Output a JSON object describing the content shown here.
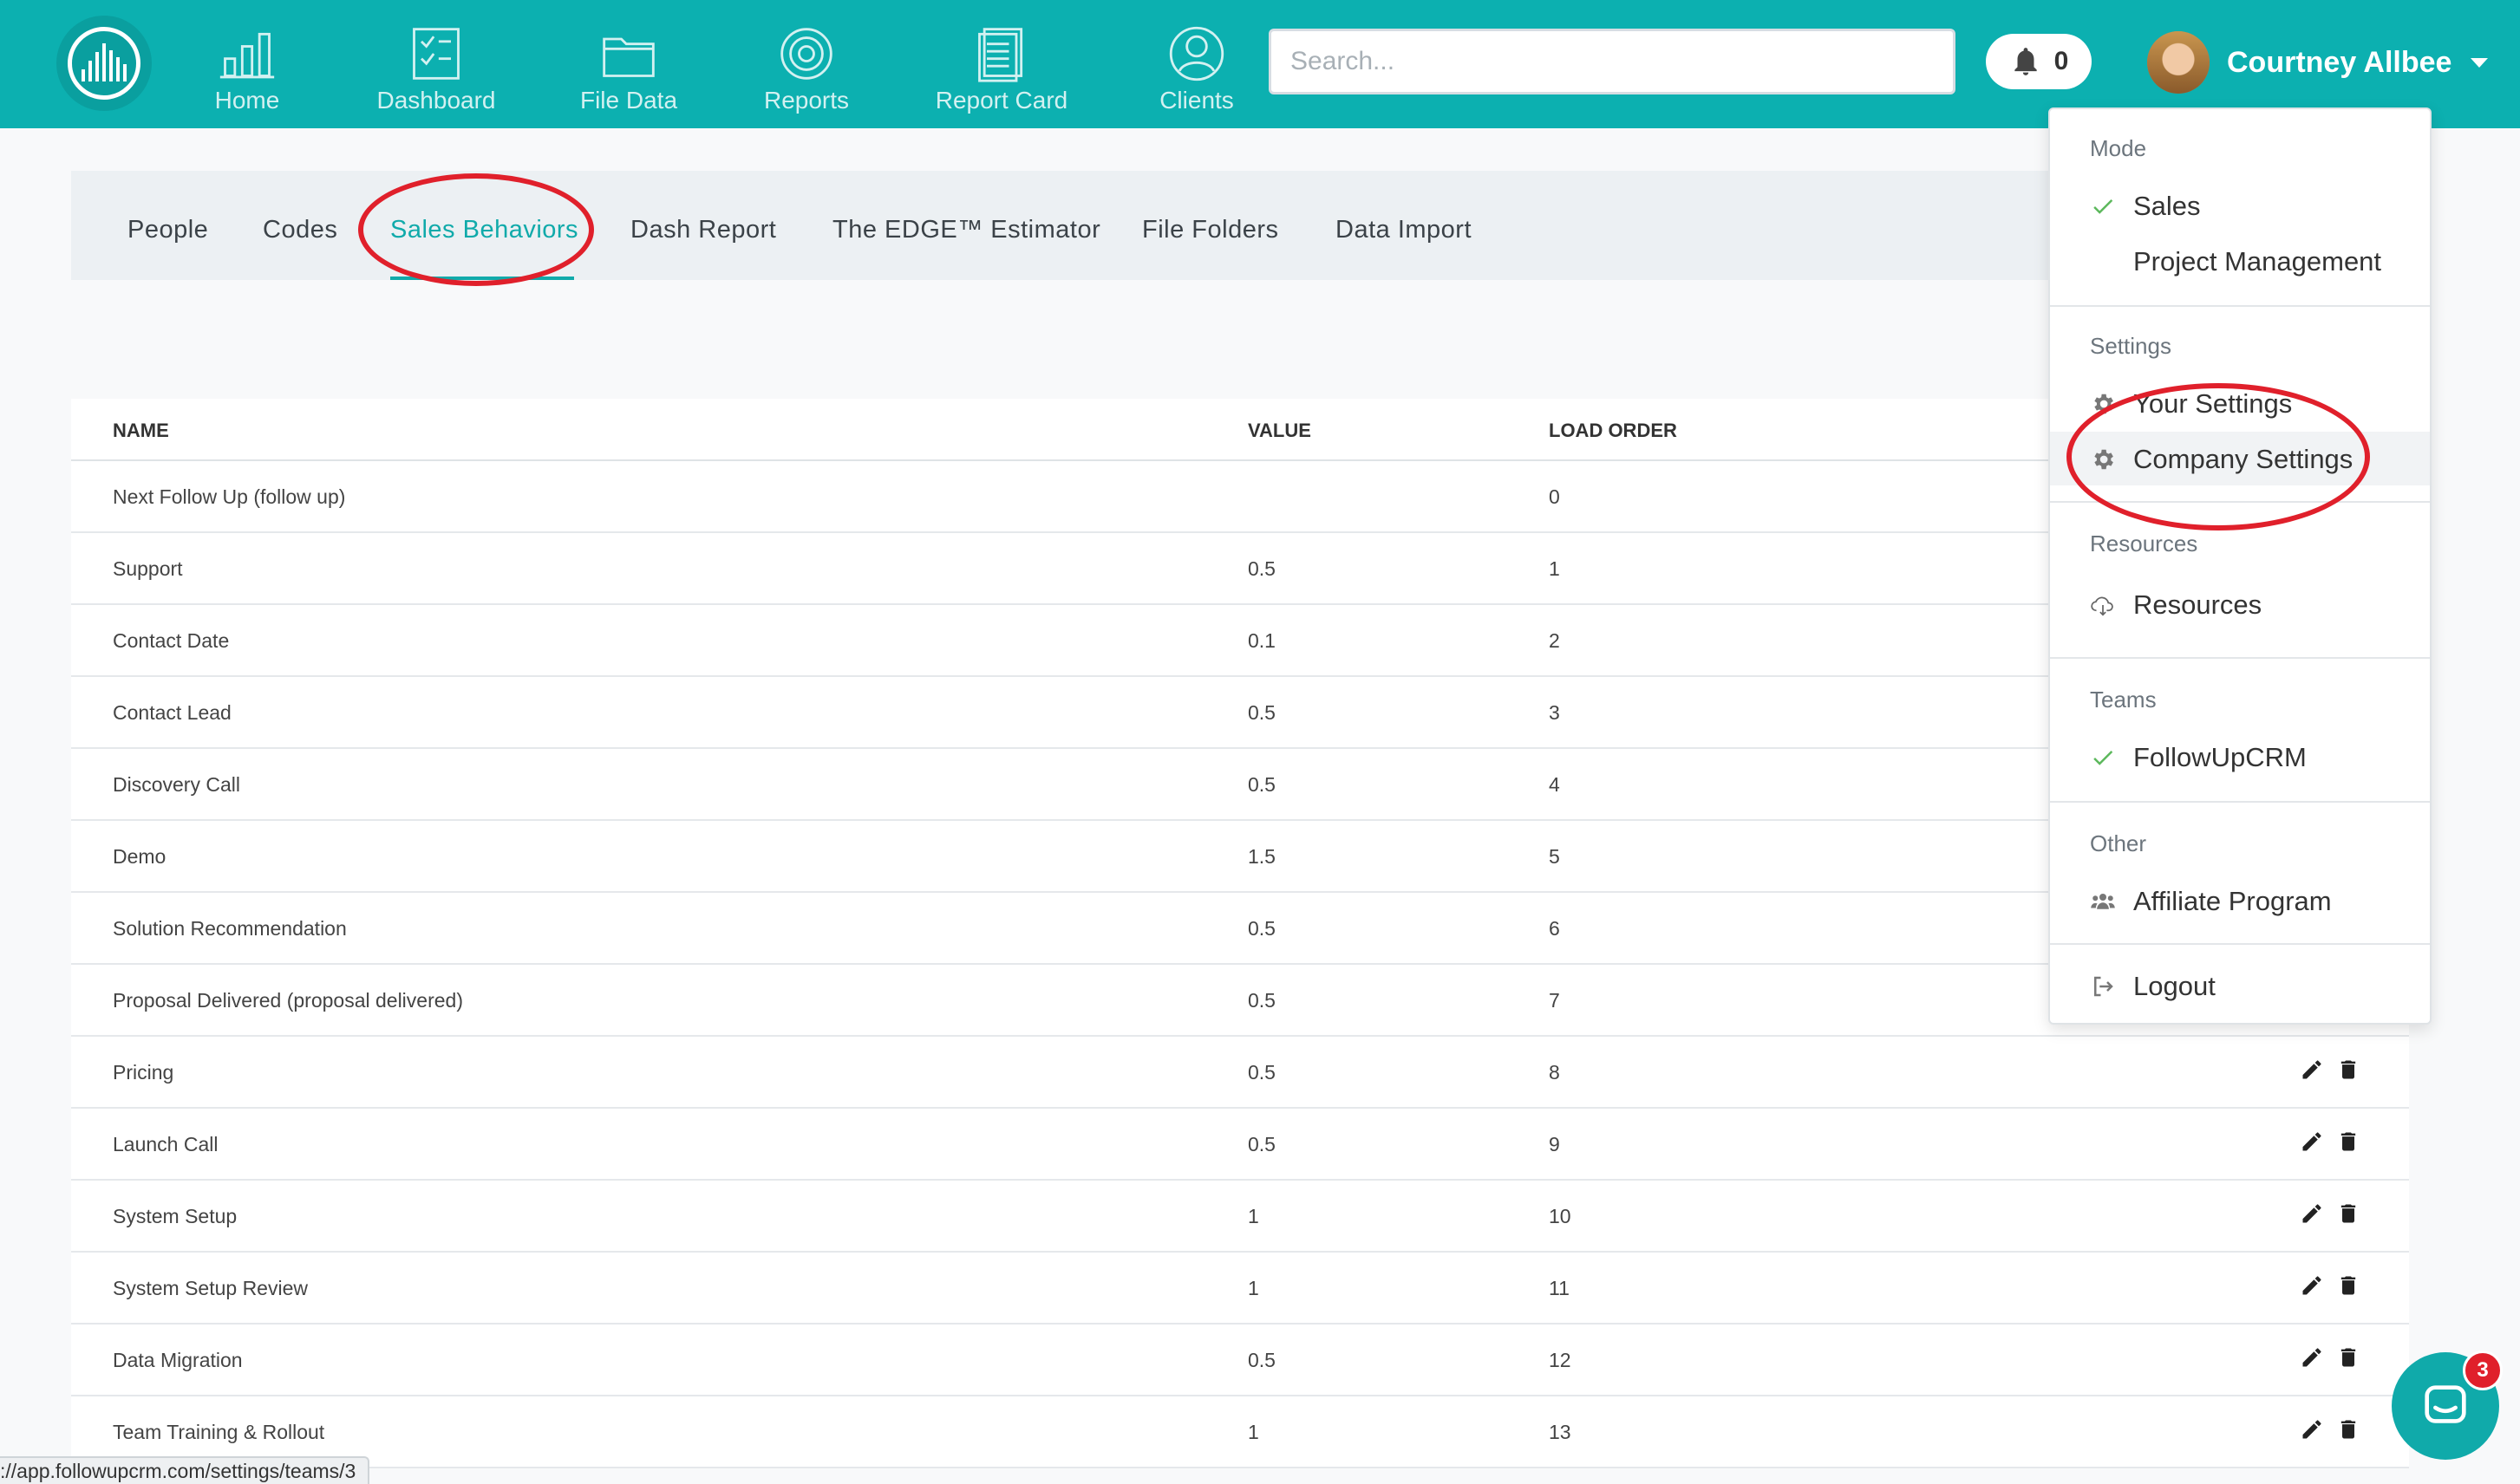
{
  "nav": {
    "items": [
      {
        "label": "Home",
        "icon": "bar-chart-icon"
      },
      {
        "label": "Dashboard",
        "icon": "checklist-icon"
      },
      {
        "label": "File Data",
        "icon": "folder-icon"
      },
      {
        "label": "Reports",
        "icon": "target-icon"
      },
      {
        "label": "Report Card",
        "icon": "document-icon"
      },
      {
        "label": "Clients",
        "icon": "user-icon"
      }
    ],
    "search_placeholder": "Search...",
    "notification_count": "0",
    "user_name": "Courtney Allbee"
  },
  "tabs": [
    {
      "label": "People"
    },
    {
      "label": "Codes"
    },
    {
      "label": "Sales Behaviors",
      "active": true
    },
    {
      "label": "Dash Report"
    },
    {
      "label": "The EDGE™ Estimator"
    },
    {
      "label": "File Folders"
    },
    {
      "label": "Data Import"
    }
  ],
  "table": {
    "headers": {
      "name": "NAME",
      "value": "VALUE",
      "load_order": "LOAD ORDER"
    },
    "rows": [
      {
        "name": "Next Follow Up (follow up)",
        "value": "",
        "load_order": "0"
      },
      {
        "name": "Support",
        "value": "0.5",
        "load_order": "1"
      },
      {
        "name": "Contact Date",
        "value": "0.1",
        "load_order": "2"
      },
      {
        "name": "Contact Lead",
        "value": "0.5",
        "load_order": "3"
      },
      {
        "name": "Discovery Call",
        "value": "0.5",
        "load_order": "4"
      },
      {
        "name": "Demo",
        "value": "1.5",
        "load_order": "5"
      },
      {
        "name": "Solution Recommendation",
        "value": "0.5",
        "load_order": "6"
      },
      {
        "name": "Proposal Delivered (proposal delivered)",
        "value": "0.5",
        "load_order": "7"
      },
      {
        "name": "Pricing",
        "value": "0.5",
        "load_order": "8"
      },
      {
        "name": "Launch Call",
        "value": "0.5",
        "load_order": "9"
      },
      {
        "name": "System Setup",
        "value": "1",
        "load_order": "10"
      },
      {
        "name": "System Setup Review",
        "value": "1",
        "load_order": "11"
      },
      {
        "name": "Data Migration",
        "value": "0.5",
        "load_order": "12"
      },
      {
        "name": "Team Training & Rollout",
        "value": "1",
        "load_order": "13"
      }
    ]
  },
  "menu": {
    "mode_heading": "Mode",
    "mode_sales": "Sales",
    "mode_pm": "Project Management",
    "settings_heading": "Settings",
    "your_settings": "Your Settings",
    "company_settings": "Company Settings",
    "resources_heading": "Resources",
    "resources": "Resources",
    "teams_heading": "Teams",
    "team_name": "FollowUpCRM",
    "other_heading": "Other",
    "affiliate": "Affiliate Program",
    "logout": "Logout"
  },
  "status_url": "://app.followupcrm.com/settings/teams/3",
  "chat_badge": "3",
  "colors": {
    "brand": "#0cb0b0",
    "accent": "#10aaaa",
    "annotation": "#e0202b",
    "check": "#5cb85c"
  }
}
